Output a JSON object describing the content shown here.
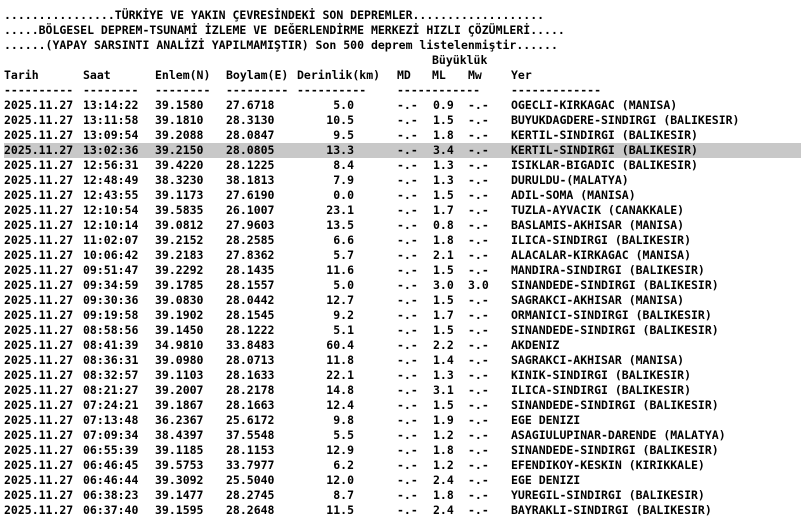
{
  "header": {
    "line1": "................TÜRKİYE VE YAKIN ÇEVRESİNDEKİ SON DEPREMLER...................",
    "line2": ".....BÖLGESEL DEPREM-TSUNAMİ İZLEME VE DEĞERLENDİRME MERKEZİ HIZLI ÇÖZÜMLERİ.....",
    "line3": "......(YAPAY SARSINTI ANALİZİ YAPILMAMIŞTIR) Son 500 deprem listelenmiştir......"
  },
  "magnitude_group_label": "Büyüklük",
  "columns": {
    "date": "Tarih",
    "time": "Saat",
    "lat": "Enlem(N)",
    "lon": "Boylam(E)",
    "depth": "Derinlik(km)",
    "md": "MD",
    "ml": "ML",
    "mw": "Mw",
    "place": "Yer"
  },
  "dashes": {
    "date": "----------",
    "time": "--------",
    "lat": "--------",
    "lon": "---------",
    "depth": "----------",
    "md": "------------",
    "place": "-------------"
  },
  "selected_row_index": 3,
  "rows": [
    {
      "date": "2025.11.27",
      "time": "13:14:22",
      "lat": "39.1580",
      "lon": "27.6718",
      "depth": "5.0",
      "md": "-.-",
      "ml": "0.9",
      "mw": "-.-",
      "place": "OGECLI-KIRKAGAC (MANISA)"
    },
    {
      "date": "2025.11.27",
      "time": "13:11:58",
      "lat": "39.1810",
      "lon": "28.3130",
      "depth": "10.5",
      "md": "-.-",
      "ml": "1.5",
      "mw": "-.-",
      "place": "BUYUKDAGDERE-SINDIRGI (BALIKESIR)"
    },
    {
      "date": "2025.11.27",
      "time": "13:09:54",
      "lat": "39.2088",
      "lon": "28.0847",
      "depth": "9.5",
      "md": "-.-",
      "ml": "1.8",
      "mw": "-.-",
      "place": "KERTIL-SINDIRGI (BALIKESIR)"
    },
    {
      "date": "2025.11.27",
      "time": "13:02:36",
      "lat": "39.2150",
      "lon": "28.0805",
      "depth": "13.3",
      "md": "-.-",
      "ml": "3.4",
      "mw": "-.-",
      "place": "KERTIL-SINDIRGI (BALIKESIR)"
    },
    {
      "date": "2025.11.27",
      "time": "12:56:31",
      "lat": "39.4220",
      "lon": "28.1225",
      "depth": "8.4",
      "md": "-.-",
      "ml": "1.3",
      "mw": "-.-",
      "place": "ISIKLAR-BIGADIC (BALIKESIR)"
    },
    {
      "date": "2025.11.27",
      "time": "12:48:49",
      "lat": "38.3230",
      "lon": "38.1813",
      "depth": "7.9",
      "md": "-.-",
      "ml": "1.3",
      "mw": "-.-",
      "place": "DURULDU-(MALATYA)"
    },
    {
      "date": "2025.11.27",
      "time": "12:43:55",
      "lat": "39.1173",
      "lon": "27.6190",
      "depth": "0.0",
      "md": "-.-",
      "ml": "1.5",
      "mw": "-.-",
      "place": "ADIL-SOMA (MANISA)"
    },
    {
      "date": "2025.11.27",
      "time": "12:10:54",
      "lat": "39.5835",
      "lon": "26.1007",
      "depth": "23.1",
      "md": "-.-",
      "ml": "1.7",
      "mw": "-.-",
      "place": "TUZLA-AYVACIK (CANAKKALE)"
    },
    {
      "date": "2025.11.27",
      "time": "12:10:14",
      "lat": "39.0812",
      "lon": "27.9603",
      "depth": "13.5",
      "md": "-.-",
      "ml": "0.8",
      "mw": "-.-",
      "place": "BASLAMIS-AKHISAR (MANISA)"
    },
    {
      "date": "2025.11.27",
      "time": "11:02:07",
      "lat": "39.2152",
      "lon": "28.2585",
      "depth": "6.6",
      "md": "-.-",
      "ml": "1.8",
      "mw": "-.-",
      "place": "ILICA-SINDIRGI (BALIKESIR)"
    },
    {
      "date": "2025.11.27",
      "time": "10:06:42",
      "lat": "39.2183",
      "lon": "27.8362",
      "depth": "5.7",
      "md": "-.-",
      "ml": "2.1",
      "mw": "-.-",
      "place": "ALACALAR-KIRKAGAC (MANISA)"
    },
    {
      "date": "2025.11.27",
      "time": "09:51:47",
      "lat": "39.2292",
      "lon": "28.1435",
      "depth": "11.6",
      "md": "-.-",
      "ml": "1.5",
      "mw": "-.-",
      "place": "MANDIRA-SINDIRGI (BALIKESIR)"
    },
    {
      "date": "2025.11.27",
      "time": "09:34:59",
      "lat": "39.1785",
      "lon": "28.1557",
      "depth": "5.0",
      "md": "-.-",
      "ml": "3.0",
      "mw": "3.0",
      "place": "SINANDEDE-SINDIRGI (BALIKESIR)"
    },
    {
      "date": "2025.11.27",
      "time": "09:30:36",
      "lat": "39.0830",
      "lon": "28.0442",
      "depth": "12.7",
      "md": "-.-",
      "ml": "1.5",
      "mw": "-.-",
      "place": "SAGRAKCI-AKHISAR (MANISA)"
    },
    {
      "date": "2025.11.27",
      "time": "09:19:58",
      "lat": "39.1902",
      "lon": "28.1545",
      "depth": "9.2",
      "md": "-.-",
      "ml": "1.7",
      "mw": "-.-",
      "place": "ORMANICI-SINDIRGI (BALIKESIR)"
    },
    {
      "date": "2025.11.27",
      "time": "08:58:56",
      "lat": "39.1450",
      "lon": "28.1222",
      "depth": "5.1",
      "md": "-.-",
      "ml": "1.5",
      "mw": "-.-",
      "place": "SINANDEDE-SINDIRGI (BALIKESIR)"
    },
    {
      "date": "2025.11.27",
      "time": "08:41:39",
      "lat": "34.9810",
      "lon": "33.8483",
      "depth": "60.4",
      "md": "-.-",
      "ml": "2.2",
      "mw": "-.-",
      "place": "AKDENIZ"
    },
    {
      "date": "2025.11.27",
      "time": "08:36:31",
      "lat": "39.0980",
      "lon": "28.0713",
      "depth": "11.8",
      "md": "-.-",
      "ml": "1.4",
      "mw": "-.-",
      "place": "SAGRAKCI-AKHISAR (MANISA)"
    },
    {
      "date": "2025.11.27",
      "time": "08:32:57",
      "lat": "39.1103",
      "lon": "28.1633",
      "depth": "22.1",
      "md": "-.-",
      "ml": "1.3",
      "mw": "-.-",
      "place": "KINIK-SINDIRGI (BALIKESIR)"
    },
    {
      "date": "2025.11.27",
      "time": "08:21:27",
      "lat": "39.2007",
      "lon": "28.2178",
      "depth": "14.8",
      "md": "-.-",
      "ml": "3.1",
      "mw": "-.-",
      "place": "ILICA-SINDIRGI (BALIKESIR)"
    },
    {
      "date": "2025.11.27",
      "time": "07:24:21",
      "lat": "39.1867",
      "lon": "28.1663",
      "depth": "12.4",
      "md": "-.-",
      "ml": "1.5",
      "mw": "-.-",
      "place": "SINANDEDE-SINDIRGI (BALIKESIR)"
    },
    {
      "date": "2025.11.27",
      "time": "07:13:48",
      "lat": "36.2367",
      "lon": "25.6172",
      "depth": "9.8",
      "md": "-.-",
      "ml": "1.9",
      "mw": "-.-",
      "place": "EGE DENIZI"
    },
    {
      "date": "2025.11.27",
      "time": "07:09:34",
      "lat": "38.4397",
      "lon": "37.5548",
      "depth": "5.5",
      "md": "-.-",
      "ml": "1.2",
      "mw": "-.-",
      "place": "ASAGIULUPINAR-DARENDE (MALATYA)"
    },
    {
      "date": "2025.11.27",
      "time": "06:55:39",
      "lat": "39.1185",
      "lon": "28.1153",
      "depth": "12.9",
      "md": "-.-",
      "ml": "1.8",
      "mw": "-.-",
      "place": "SINANDEDE-SINDIRGI (BALIKESIR)"
    },
    {
      "date": "2025.11.27",
      "time": "06:46:45",
      "lat": "39.5753",
      "lon": "33.7977",
      "depth": "6.2",
      "md": "-.-",
      "ml": "1.2",
      "mw": "-.-",
      "place": "EFENDIKOY-KESKIN (KIRIKKALE)"
    },
    {
      "date": "2025.11.27",
      "time": "06:46:44",
      "lat": "39.3092",
      "lon": "25.5040",
      "depth": "12.0",
      "md": "-.-",
      "ml": "2.4",
      "mw": "-.-",
      "place": "EGE DENIZI"
    },
    {
      "date": "2025.11.27",
      "time": "06:38:23",
      "lat": "39.1477",
      "lon": "28.2745",
      "depth": "8.7",
      "md": "-.-",
      "ml": "1.8",
      "mw": "-.-",
      "place": "YUREGIL-SINDIRGI (BALIKESIR)"
    },
    {
      "date": "2025.11.27",
      "time": "06:37:40",
      "lat": "39.1595",
      "lon": "28.2648",
      "depth": "11.5",
      "md": "-.-",
      "ml": "2.4",
      "mw": "-.-",
      "place": "BAYRAKLI-SINDIRGI (BALIKESIR)"
    }
  ]
}
